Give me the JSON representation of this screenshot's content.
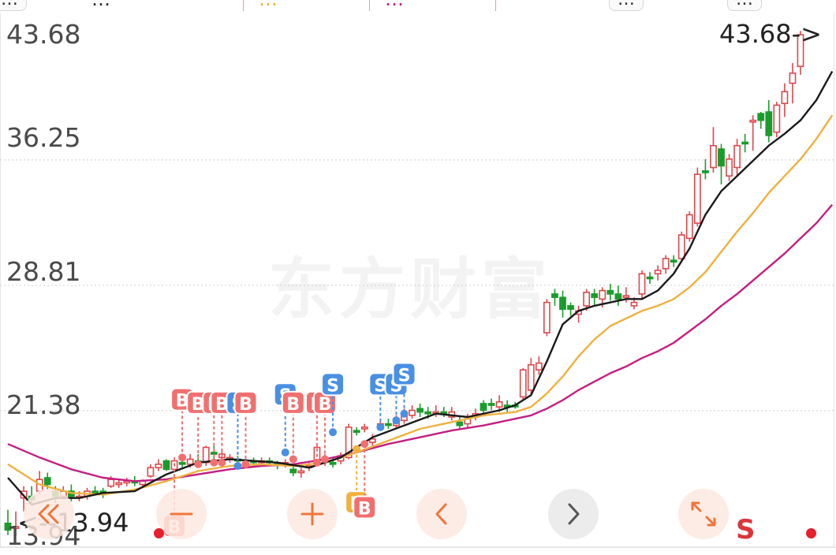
{
  "top_bar": {
    "period_tab": "…",
    "price_fragment": "…",
    "ma_fragment_1": "…",
    "ma_fragment_2": "…",
    "timeframe_button": "…",
    "adjust_button": "…"
  },
  "axis": {
    "y_ticks": [
      "43.68",
      "36.25",
      "28.81",
      "21.38",
      "13.94"
    ]
  },
  "max_marker": "43.68->",
  "min_marker": "<--13.94",
  "watermark": "东方财富",
  "s_label": "S",
  "colors": {
    "up": "#e0474c",
    "down": "#1a9c2c",
    "ma_short": "#1a1a1a",
    "ma_mid": "#f0b13e",
    "ma_long": "#c41e82",
    "buy_marker": "#f07070",
    "sell_marker": "#4a90e2",
    "control_bg": "#fde9e1",
    "control_icon": "#f0763a"
  },
  "controls": [
    {
      "name": "double-chevron-left-icon"
    },
    {
      "name": "zoom-out-button"
    },
    {
      "name": "zoom-in-button"
    },
    {
      "name": "pan-left-button"
    },
    {
      "name": "pan-right-button"
    },
    {
      "name": "expand-icon"
    }
  ],
  "chart_data": {
    "type": "candlestick",
    "ylim": [
      13.94,
      43.68
    ],
    "y_ticks": [
      43.68,
      36.25,
      28.81,
      21.38,
      13.94
    ],
    "max_value": 43.68,
    "min_value": 13.94,
    "grid": true,
    "candles": [
      [
        14.7,
        14.3,
        15.5,
        14.0,
        0
      ],
      [
        14.4,
        14.5,
        15.4,
        13.94,
        1
      ],
      [
        16.2,
        16.6,
        16.9,
        15.4,
        1
      ],
      [
        16.3,
        16.1,
        16.9,
        15.8,
        0
      ],
      [
        16.6,
        17.3,
        17.8,
        16.4,
        1
      ],
      [
        17.4,
        17.0,
        17.7,
        16.7,
        0
      ],
      [
        16.6,
        16.3,
        16.9,
        15.9,
        0
      ],
      [
        16.3,
        16.6,
        16.9,
        16.1,
        1
      ],
      [
        16.6,
        16.3,
        17.0,
        16.0,
        0
      ],
      [
        16.2,
        16.3,
        16.6,
        16.0,
        1
      ],
      [
        16.3,
        16.6,
        16.8,
        16.1,
        1
      ],
      [
        16.6,
        16.6,
        16.9,
        16.4,
        0
      ],
      [
        16.6,
        16.4,
        16.8,
        16.2,
        0
      ],
      [
        16.9,
        17.3,
        17.5,
        16.8,
        1
      ],
      [
        17.0,
        17.1,
        17.3,
        16.8,
        1
      ],
      [
        17.1,
        17.2,
        17.4,
        16.9,
        1
      ],
      [
        17.2,
        17.1,
        17.5,
        16.9,
        0
      ],
      [
        17.0,
        17.2,
        17.3,
        16.9,
        1
      ],
      [
        17.5,
        18.0,
        18.2,
        17.4,
        1
      ],
      [
        18.0,
        18.2,
        18.5,
        17.8,
        1
      ],
      [
        18.4,
        17.9,
        18.5,
        17.8,
        0
      ],
      [
        17.9,
        18.4,
        18.6,
        17.8,
        1
      ],
      [
        18.3,
        18.2,
        18.5,
        17.9,
        0
      ],
      [
        18.2,
        18.5,
        18.8,
        18.0,
        1
      ],
      [
        18.4,
        18.3,
        18.8,
        18.1,
        0
      ],
      [
        18.3,
        19.2,
        19.3,
        18.1,
        1
      ],
      [
        18.8,
        18.9,
        19.3,
        18.5,
        0
      ],
      [
        18.8,
        18.6,
        19.0,
        18.4,
        1
      ],
      [
        18.6,
        18.5,
        18.8,
        18.3,
        1
      ],
      [
        18.5,
        18.4,
        18.7,
        18.1,
        0
      ],
      [
        18.2,
        18.3,
        18.5,
        18.0,
        1
      ],
      [
        18.4,
        18.3,
        18.6,
        18.1,
        0
      ],
      [
        18.3,
        18.4,
        18.6,
        18.1,
        1
      ],
      [
        18.4,
        18.3,
        18.6,
        18.1,
        0
      ],
      [
        18.3,
        18.2,
        18.4,
        17.9,
        0
      ],
      [
        18.2,
        18.3,
        18.5,
        18.0,
        1
      ],
      [
        17.7,
        17.9,
        18.1,
        17.5,
        0
      ],
      [
        17.8,
        17.7,
        18.0,
        17.4,
        1
      ],
      [
        18.0,
        18.1,
        18.3,
        17.8,
        1
      ],
      [
        18.4,
        19.2,
        19.4,
        18.2,
        1
      ],
      [
        18.6,
        18.4,
        18.8,
        18.1,
        1
      ],
      [
        18.3,
        18.2,
        18.6,
        18.0,
        0
      ],
      [
        18.4,
        18.7,
        18.9,
        18.2,
        1
      ],
      [
        18.6,
        20.4,
        20.6,
        18.5,
        1
      ],
      [
        20.2,
        20.1,
        20.4,
        19.9,
        0
      ],
      [
        20.3,
        20.4,
        20.6,
        20.1,
        1
      ],
      [
        19.5,
        19.7,
        20.0,
        19.2,
        1
      ],
      [
        20.4,
        20.6,
        20.9,
        20.2,
        1
      ],
      [
        20.6,
        20.6,
        20.9,
        20.3,
        0
      ],
      [
        20.5,
        20.9,
        21.1,
        20.3,
        1
      ],
      [
        20.8,
        21.2,
        21.5,
        20.6,
        1
      ],
      [
        21.1,
        21.4,
        21.7,
        20.9,
        1
      ],
      [
        21.5,
        21.3,
        21.8,
        21.0,
        0
      ],
      [
        21.3,
        21.2,
        21.6,
        20.9,
        0
      ],
      [
        21.3,
        21.3,
        21.7,
        21.0,
        1
      ],
      [
        21.3,
        21.2,
        21.6,
        21.0,
        0
      ],
      [
        21.0,
        21.3,
        21.6,
        20.8,
        1
      ],
      [
        20.7,
        20.5,
        21.0,
        20.3,
        0
      ],
      [
        20.6,
        20.9,
        21.2,
        20.3,
        1
      ],
      [
        21.0,
        21.2,
        21.5,
        20.8,
        1
      ],
      [
        21.4,
        21.8,
        22.0,
        21.2,
        0
      ],
      [
        21.8,
        21.7,
        22.1,
        21.4,
        0
      ],
      [
        21.6,
        21.9,
        22.3,
        21.3,
        1
      ],
      [
        21.7,
        21.6,
        22.0,
        21.3,
        0
      ],
      [
        21.7,
        21.7,
        21.9,
        21.5,
        0
      ],
      [
        22.2,
        23.8,
        23.9,
        22.0,
        1
      ],
      [
        22.6,
        24.1,
        24.5,
        22.3,
        1
      ],
      [
        23.8,
        24.2,
        24.6,
        23.5,
        1
      ],
      [
        26.0,
        27.8,
        28.0,
        25.8,
        1
      ],
      [
        28.1,
        28.3,
        28.6,
        27.6,
        0
      ],
      [
        28.1,
        27.4,
        28.5,
        26.9,
        0
      ],
      [
        27.6,
        27.4,
        27.8,
        27.0,
        0
      ],
      [
        27.1,
        27.3,
        27.6,
        26.6,
        1
      ],
      [
        27.6,
        28.4,
        28.6,
        27.3,
        1
      ],
      [
        28.3,
        28.1,
        28.6,
        27.6,
        0
      ],
      [
        28.0,
        28.5,
        28.7,
        27.5,
        1
      ],
      [
        28.5,
        28.3,
        28.9,
        27.9,
        0
      ],
      [
        28.3,
        28.0,
        28.8,
        27.6,
        0
      ],
      [
        28.1,
        28.2,
        28.7,
        27.8,
        1
      ],
      [
        27.8,
        27.6,
        28.1,
        27.4,
        1
      ],
      [
        28.3,
        29.5,
        29.7,
        28.0,
        1
      ],
      [
        29.3,
        29.3,
        29.6,
        28.9,
        0
      ],
      [
        29.5,
        29.7,
        30.0,
        29.1,
        1
      ],
      [
        29.8,
        30.4,
        30.6,
        29.5,
        1
      ],
      [
        30.2,
        30.3,
        30.6,
        29.9,
        0
      ],
      [
        30.4,
        31.8,
        32.0,
        30.2,
        1
      ],
      [
        31.6,
        33.0,
        33.2,
        31.4,
        1
      ],
      [
        32.5,
        35.4,
        35.8,
        32.3,
        1
      ],
      [
        35.5,
        35.6,
        36.3,
        35.1,
        0
      ],
      [
        35.8,
        37.1,
        38.2,
        35.5,
        1
      ],
      [
        36.9,
        35.9,
        37.2,
        34.8,
        0
      ],
      [
        36.3,
        35.3,
        36.6,
        35.0,
        1
      ],
      [
        35.8,
        37.1,
        37.5,
        35.3,
        1
      ],
      [
        37.3,
        37.3,
        37.8,
        36.7,
        0
      ],
      [
        38.5,
        38.6,
        38.9,
        36.8,
        1
      ],
      [
        39.0,
        38.6,
        39.1,
        38.1,
        0
      ],
      [
        39.1,
        37.7,
        39.8,
        37.3,
        0
      ],
      [
        37.9,
        39.5,
        39.7,
        37.6,
        1
      ],
      [
        39.6,
        40.3,
        40.8,
        38.8,
        1
      ],
      [
        40.8,
        41.4,
        42.0,
        39.6,
        1
      ],
      [
        41.8,
        43.68,
        43.9,
        41.3,
        1
      ]
    ],
    "ma_short": [
      [
        0,
        17.4
      ],
      [
        3,
        15.8
      ],
      [
        6,
        16.2
      ],
      [
        9,
        16.2
      ],
      [
        12,
        16.5
      ],
      [
        16,
        16.6
      ],
      [
        20,
        17.6
      ],
      [
        24,
        18.3
      ],
      [
        28,
        18.5
      ],
      [
        34,
        18.3
      ],
      [
        38,
        18.0
      ],
      [
        42,
        18.6
      ],
      [
        46,
        19.8
      ],
      [
        50,
        20.5
      ],
      [
        54,
        21.2
      ],
      [
        58,
        21.0
      ],
      [
        62,
        21.4
      ],
      [
        64,
        21.7
      ],
      [
        66,
        22.3
      ],
      [
        68,
        24.3
      ],
      [
        70,
        26.5
      ],
      [
        72,
        27.3
      ],
      [
        74,
        27.6
      ],
      [
        78,
        28.0
      ],
      [
        80,
        28.0
      ],
      [
        82,
        28.5
      ],
      [
        84,
        29.5
      ],
      [
        86,
        31.0
      ],
      [
        88,
        33.0
      ],
      [
        90,
        34.4
      ],
      [
        92,
        35.3
      ],
      [
        94,
        36.2
      ],
      [
        96,
        37.1
      ],
      [
        98,
        37.8
      ],
      [
        100,
        38.6
      ],
      [
        102,
        39.8
      ],
      [
        104,
        41.5
      ]
    ],
    "ma_mid": [
      [
        0,
        18.2
      ],
      [
        4,
        17.0
      ],
      [
        8,
        16.5
      ],
      [
        12,
        16.4
      ],
      [
        16,
        16.7
      ],
      [
        20,
        17.2
      ],
      [
        24,
        17.8
      ],
      [
        28,
        18.1
      ],
      [
        32,
        18.2
      ],
      [
        36,
        18.1
      ],
      [
        40,
        18.3
      ],
      [
        44,
        18.9
      ],
      [
        48,
        19.6
      ],
      [
        52,
        20.3
      ],
      [
        56,
        20.7
      ],
      [
        60,
        21.1
      ],
      [
        64,
        21.3
      ],
      [
        66,
        21.6
      ],
      [
        68,
        22.4
      ],
      [
        70,
        23.4
      ],
      [
        72,
        24.6
      ],
      [
        74,
        25.6
      ],
      [
        76,
        26.4
      ],
      [
        80,
        27.3
      ],
      [
        82,
        27.6
      ],
      [
        84,
        28.0
      ],
      [
        86,
        28.7
      ],
      [
        88,
        29.6
      ],
      [
        90,
        30.8
      ],
      [
        92,
        32.0
      ],
      [
        94,
        33.1
      ],
      [
        96,
        34.3
      ],
      [
        98,
        35.3
      ],
      [
        100,
        36.3
      ],
      [
        102,
        37.5
      ],
      [
        104,
        38.9
      ]
    ],
    "ma_long": [
      [
        0,
        19.4
      ],
      [
        4,
        18.6
      ],
      [
        8,
        17.9
      ],
      [
        12,
        17.4
      ],
      [
        16,
        17.2
      ],
      [
        20,
        17.3
      ],
      [
        24,
        17.6
      ],
      [
        28,
        17.9
      ],
      [
        32,
        18.1
      ],
      [
        36,
        18.2
      ],
      [
        40,
        18.5
      ],
      [
        44,
        18.9
      ],
      [
        48,
        19.4
      ],
      [
        52,
        19.8
      ],
      [
        56,
        20.2
      ],
      [
        60,
        20.5
      ],
      [
        64,
        20.9
      ],
      [
        66,
        21.1
      ],
      [
        68,
        21.5
      ],
      [
        70,
        22.0
      ],
      [
        72,
        22.6
      ],
      [
        74,
        23.1
      ],
      [
        76,
        23.6
      ],
      [
        78,
        24.0
      ],
      [
        80,
        24.5
      ],
      [
        82,
        24.9
      ],
      [
        84,
        25.4
      ],
      [
        86,
        26.1
      ],
      [
        88,
        26.8
      ],
      [
        90,
        27.6
      ],
      [
        92,
        28.3
      ],
      [
        94,
        29.1
      ],
      [
        96,
        29.9
      ],
      [
        98,
        30.7
      ],
      [
        100,
        31.6
      ],
      [
        102,
        32.5
      ],
      [
        104,
        33.6
      ]
    ],
    "trade_markers": [
      {
        "i": 22,
        "price": 18.6,
        "kind": "B",
        "label_price": 22.0
      },
      {
        "i": 24,
        "price": 18.2,
        "kind": "B",
        "label_price": 21.8
      },
      {
        "i": 26,
        "price": 18.3,
        "kind": "B",
        "label_price": 21.8
      },
      {
        "i": 27,
        "price": 18.3,
        "kind": "B",
        "label_price": 21.8
      },
      {
        "i": 29,
        "price": 18.1,
        "kind": "S",
        "label_price": 21.8
      },
      {
        "i": 30,
        "price": 18.2,
        "kind": "B",
        "label_price": 21.8
      },
      {
        "i": 35,
        "price": 18.9,
        "kind": "S",
        "label_price": 22.3
      },
      {
        "i": 36,
        "price": 18.5,
        "kind": "B",
        "label_price": 21.8
      },
      {
        "i": 39,
        "price": 18.3,
        "kind": "B",
        "label_price": 21.8
      },
      {
        "i": 40,
        "price": 18.5,
        "kind": "B",
        "label_price": 21.8
      },
      {
        "i": 41,
        "price": 20.1,
        "kind": "S",
        "label_price": 22.9
      },
      {
        "i": 44,
        "price": 19.1,
        "kind": "B",
        "label_price": 15.9,
        "orange": true
      },
      {
        "i": 45,
        "price": 19.4,
        "kind": "B",
        "label_price": 15.6
      },
      {
        "i": 47,
        "price": 20.4,
        "kind": "S",
        "label_price": 22.9
      },
      {
        "i": 49,
        "price": 20.8,
        "kind": "S",
        "label_price": 22.9
      },
      {
        "i": 50,
        "price": 21.2,
        "kind": "S",
        "label_price": 23.5
      }
    ],
    "extra_b_label": {
      "i": 21,
      "price": 14.5
    }
  }
}
